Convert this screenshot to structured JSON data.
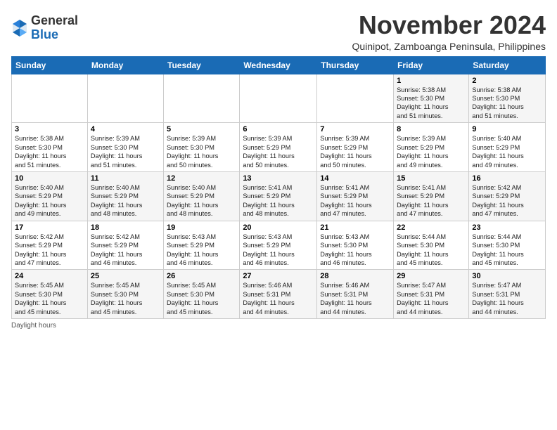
{
  "logo": {
    "general": "General",
    "blue": "Blue"
  },
  "title": "November 2024",
  "subtitle": "Quinipot, Zamboanga Peninsula, Philippines",
  "days_header": [
    "Sunday",
    "Monday",
    "Tuesday",
    "Wednesday",
    "Thursday",
    "Friday",
    "Saturday"
  ],
  "footer": "Daylight hours",
  "weeks": [
    [
      {
        "day": "",
        "info": ""
      },
      {
        "day": "",
        "info": ""
      },
      {
        "day": "",
        "info": ""
      },
      {
        "day": "",
        "info": ""
      },
      {
        "day": "",
        "info": ""
      },
      {
        "day": "1",
        "info": "Sunrise: 5:38 AM\nSunset: 5:30 PM\nDaylight: 11 hours\nand 51 minutes."
      },
      {
        "day": "2",
        "info": "Sunrise: 5:38 AM\nSunset: 5:30 PM\nDaylight: 11 hours\nand 51 minutes."
      }
    ],
    [
      {
        "day": "3",
        "info": "Sunrise: 5:38 AM\nSunset: 5:30 PM\nDaylight: 11 hours\nand 51 minutes."
      },
      {
        "day": "4",
        "info": "Sunrise: 5:39 AM\nSunset: 5:30 PM\nDaylight: 11 hours\nand 51 minutes."
      },
      {
        "day": "5",
        "info": "Sunrise: 5:39 AM\nSunset: 5:30 PM\nDaylight: 11 hours\nand 50 minutes."
      },
      {
        "day": "6",
        "info": "Sunrise: 5:39 AM\nSunset: 5:29 PM\nDaylight: 11 hours\nand 50 minutes."
      },
      {
        "day": "7",
        "info": "Sunrise: 5:39 AM\nSunset: 5:29 PM\nDaylight: 11 hours\nand 50 minutes."
      },
      {
        "day": "8",
        "info": "Sunrise: 5:39 AM\nSunset: 5:29 PM\nDaylight: 11 hours\nand 49 minutes."
      },
      {
        "day": "9",
        "info": "Sunrise: 5:40 AM\nSunset: 5:29 PM\nDaylight: 11 hours\nand 49 minutes."
      }
    ],
    [
      {
        "day": "10",
        "info": "Sunrise: 5:40 AM\nSunset: 5:29 PM\nDaylight: 11 hours\nand 49 minutes."
      },
      {
        "day": "11",
        "info": "Sunrise: 5:40 AM\nSunset: 5:29 PM\nDaylight: 11 hours\nand 48 minutes."
      },
      {
        "day": "12",
        "info": "Sunrise: 5:40 AM\nSunset: 5:29 PM\nDaylight: 11 hours\nand 48 minutes."
      },
      {
        "day": "13",
        "info": "Sunrise: 5:41 AM\nSunset: 5:29 PM\nDaylight: 11 hours\nand 48 minutes."
      },
      {
        "day": "14",
        "info": "Sunrise: 5:41 AM\nSunset: 5:29 PM\nDaylight: 11 hours\nand 47 minutes."
      },
      {
        "day": "15",
        "info": "Sunrise: 5:41 AM\nSunset: 5:29 PM\nDaylight: 11 hours\nand 47 minutes."
      },
      {
        "day": "16",
        "info": "Sunrise: 5:42 AM\nSunset: 5:29 PM\nDaylight: 11 hours\nand 47 minutes."
      }
    ],
    [
      {
        "day": "17",
        "info": "Sunrise: 5:42 AM\nSunset: 5:29 PM\nDaylight: 11 hours\nand 47 minutes."
      },
      {
        "day": "18",
        "info": "Sunrise: 5:42 AM\nSunset: 5:29 PM\nDaylight: 11 hours\nand 46 minutes."
      },
      {
        "day": "19",
        "info": "Sunrise: 5:43 AM\nSunset: 5:29 PM\nDaylight: 11 hours\nand 46 minutes."
      },
      {
        "day": "20",
        "info": "Sunrise: 5:43 AM\nSunset: 5:29 PM\nDaylight: 11 hours\nand 46 minutes."
      },
      {
        "day": "21",
        "info": "Sunrise: 5:43 AM\nSunset: 5:30 PM\nDaylight: 11 hours\nand 46 minutes."
      },
      {
        "day": "22",
        "info": "Sunrise: 5:44 AM\nSunset: 5:30 PM\nDaylight: 11 hours\nand 45 minutes."
      },
      {
        "day": "23",
        "info": "Sunrise: 5:44 AM\nSunset: 5:30 PM\nDaylight: 11 hours\nand 45 minutes."
      }
    ],
    [
      {
        "day": "24",
        "info": "Sunrise: 5:45 AM\nSunset: 5:30 PM\nDaylight: 11 hours\nand 45 minutes."
      },
      {
        "day": "25",
        "info": "Sunrise: 5:45 AM\nSunset: 5:30 PM\nDaylight: 11 hours\nand 45 minutes."
      },
      {
        "day": "26",
        "info": "Sunrise: 5:45 AM\nSunset: 5:30 PM\nDaylight: 11 hours\nand 45 minutes."
      },
      {
        "day": "27",
        "info": "Sunrise: 5:46 AM\nSunset: 5:31 PM\nDaylight: 11 hours\nand 44 minutes."
      },
      {
        "day": "28",
        "info": "Sunrise: 5:46 AM\nSunset: 5:31 PM\nDaylight: 11 hours\nand 44 minutes."
      },
      {
        "day": "29",
        "info": "Sunrise: 5:47 AM\nSunset: 5:31 PM\nDaylight: 11 hours\nand 44 minutes."
      },
      {
        "day": "30",
        "info": "Sunrise: 5:47 AM\nSunset: 5:31 PM\nDaylight: 11 hours\nand 44 minutes."
      }
    ]
  ]
}
